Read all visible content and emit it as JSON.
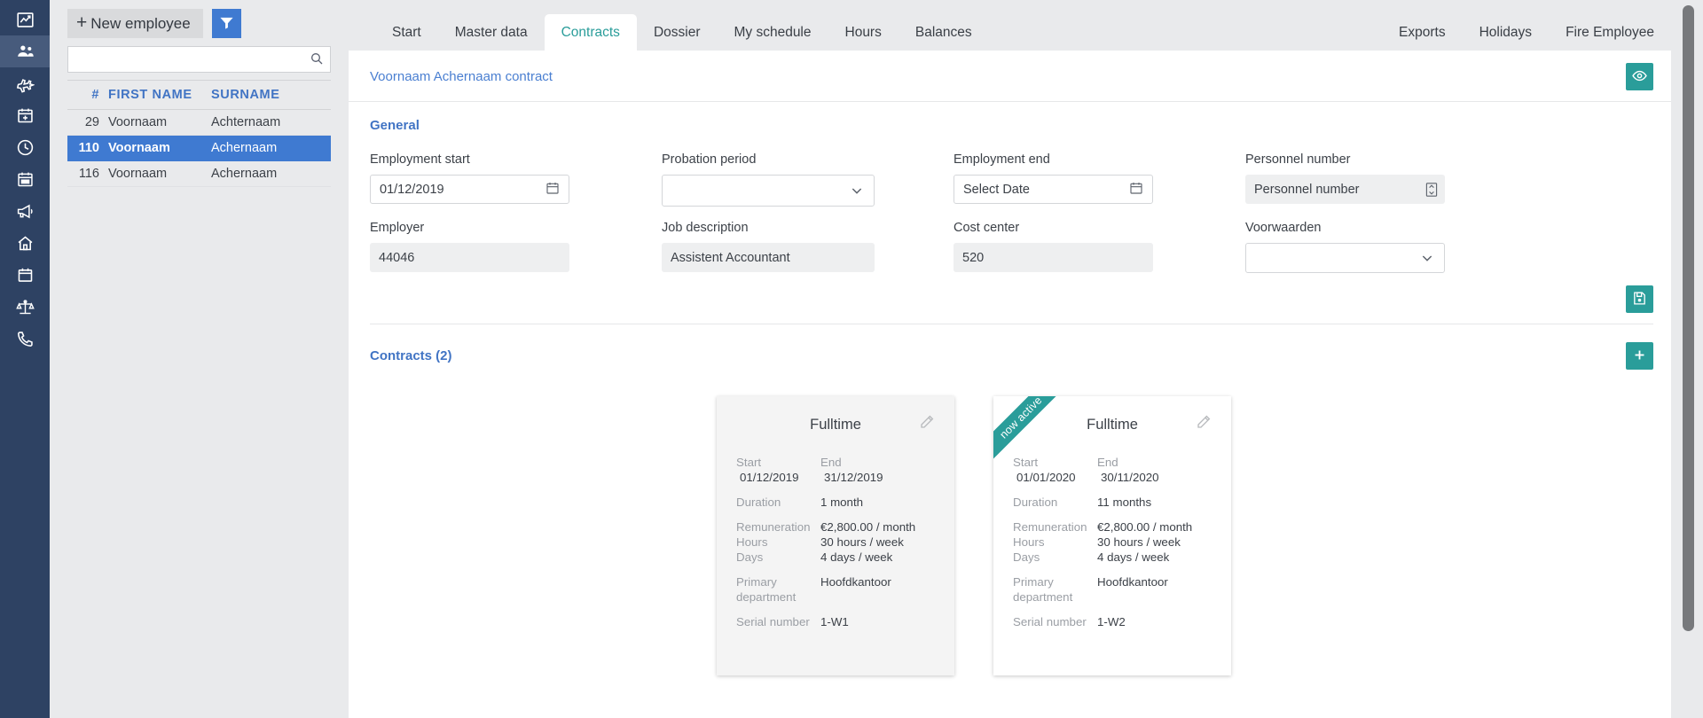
{
  "rail": {
    "items": [
      {
        "icon": "analytics-chart-icon",
        "active": false
      },
      {
        "icon": "people-users-icon",
        "active": true
      },
      {
        "icon": "airplane-icon",
        "active": false
      },
      {
        "icon": "calendar-plus-icon",
        "active": false
      },
      {
        "icon": "clock-icon",
        "active": false
      },
      {
        "icon": "calendar-grid-icon",
        "active": false
      },
      {
        "icon": "megaphone-icon",
        "active": false
      },
      {
        "icon": "home-icon",
        "active": false
      },
      {
        "icon": "calendar-blank-icon",
        "active": false
      },
      {
        "icon": "scales-balance-icon",
        "active": false
      },
      {
        "icon": "phone-icon",
        "active": false
      }
    ]
  },
  "employee_list": {
    "new_employee_label": "New employee",
    "plus_glyph": "+",
    "filter_icon": "filter-funnel-icon",
    "search": {
      "value": "",
      "placeholder": "",
      "icon": "search-icon"
    },
    "columns": [
      "#",
      "FIRST NAME",
      "SURNAME"
    ],
    "rows": [
      {
        "num": "29",
        "first": "Voornaam",
        "surname": "Achternaam",
        "selected": false
      },
      {
        "num": "110",
        "first": "Voornaam",
        "surname": "Achernaam",
        "selected": true
      },
      {
        "num": "116",
        "first": "Voornaam",
        "surname": "Achernaam",
        "selected": false
      }
    ]
  },
  "tabs": {
    "left": [
      {
        "label": "Start",
        "active": false
      },
      {
        "label": "Master data",
        "active": false
      },
      {
        "label": "Contracts",
        "active": true
      },
      {
        "label": "Dossier",
        "active": false
      },
      {
        "label": "My schedule",
        "active": false
      },
      {
        "label": "Hours",
        "active": false
      },
      {
        "label": "Balances",
        "active": false
      }
    ],
    "right": [
      {
        "label": "Exports"
      },
      {
        "label": "Holidays"
      },
      {
        "label": "Fire Employee"
      }
    ]
  },
  "breadcrumb": "Voornaam Achernaam contract",
  "preview_button_icon": "eye-icon",
  "general": {
    "title": "General",
    "fields": {
      "employment_start": {
        "label": "Employment start",
        "value": "01/12/2019",
        "placeholder": "",
        "icon": "calendar-icon"
      },
      "probation_period": {
        "label": "Probation period",
        "value": "",
        "icon": "chevron-down-icon"
      },
      "employment_end": {
        "label": "Employment end",
        "value": "",
        "placeholder": "Select Date",
        "icon": "calendar-icon"
      },
      "personnel_number": {
        "label": "Personnel number",
        "value": "",
        "placeholder": "Personnel number",
        "icon": "number-spinner-icon"
      },
      "employer": {
        "label": "Employer",
        "value": "44046"
      },
      "job_description": {
        "label": "Job description",
        "value": "Assistent Accountant"
      },
      "cost_center": {
        "label": "Cost center",
        "value": "520"
      },
      "voorwaarden": {
        "label": "Voorwaarden",
        "value": "",
        "icon": "chevron-down-icon"
      }
    },
    "save_button_icon": "save-floppy-icon"
  },
  "contracts_section": {
    "title": "Contracts (2)",
    "add_button_icon": "plus-icon",
    "cards": [
      {
        "title": "Fulltime",
        "ribbon": null,
        "style": "grey",
        "edit_icon": "pencil-edit-icon",
        "start_label": "Start",
        "start_value": "01/12/2019",
        "end_label": "End",
        "end_value": "31/12/2019",
        "rows": [
          {
            "key": "Duration",
            "value": "1 month"
          },
          {
            "key": "Remuneration",
            "value": "€2,800.00 / month"
          },
          {
            "key": "Hours",
            "value": "30 hours / week"
          },
          {
            "key": "Days",
            "value": "4 days / week"
          },
          {
            "key": "Primary department",
            "value": "Hoofdkantoor"
          },
          {
            "key": "Serial number",
            "value": "1-W1"
          }
        ]
      },
      {
        "title": "Fulltime",
        "ribbon": "now active",
        "style": "white",
        "edit_icon": "pencil-edit-icon",
        "start_label": "Start",
        "start_value": "01/01/2020",
        "end_label": "End",
        "end_value": "30/11/2020",
        "rows": [
          {
            "key": "Duration",
            "value": "11 months"
          },
          {
            "key": "Remuneration",
            "value": "€2,800.00 / month"
          },
          {
            "key": "Hours",
            "value": "30 hours / week"
          },
          {
            "key": "Days",
            "value": "4 days / week"
          },
          {
            "key": "Primary department",
            "value": "Hoofdkantoor"
          },
          {
            "key": "Serial number",
            "value": "1-W2"
          }
        ]
      }
    ]
  },
  "colors": {
    "rail_bg": "#2e4263",
    "accent_blue": "#3f7ad1",
    "accent_teal": "#2a9d9a",
    "heading_blue": "#4174c4",
    "page_bg": "#e9eaec"
  }
}
